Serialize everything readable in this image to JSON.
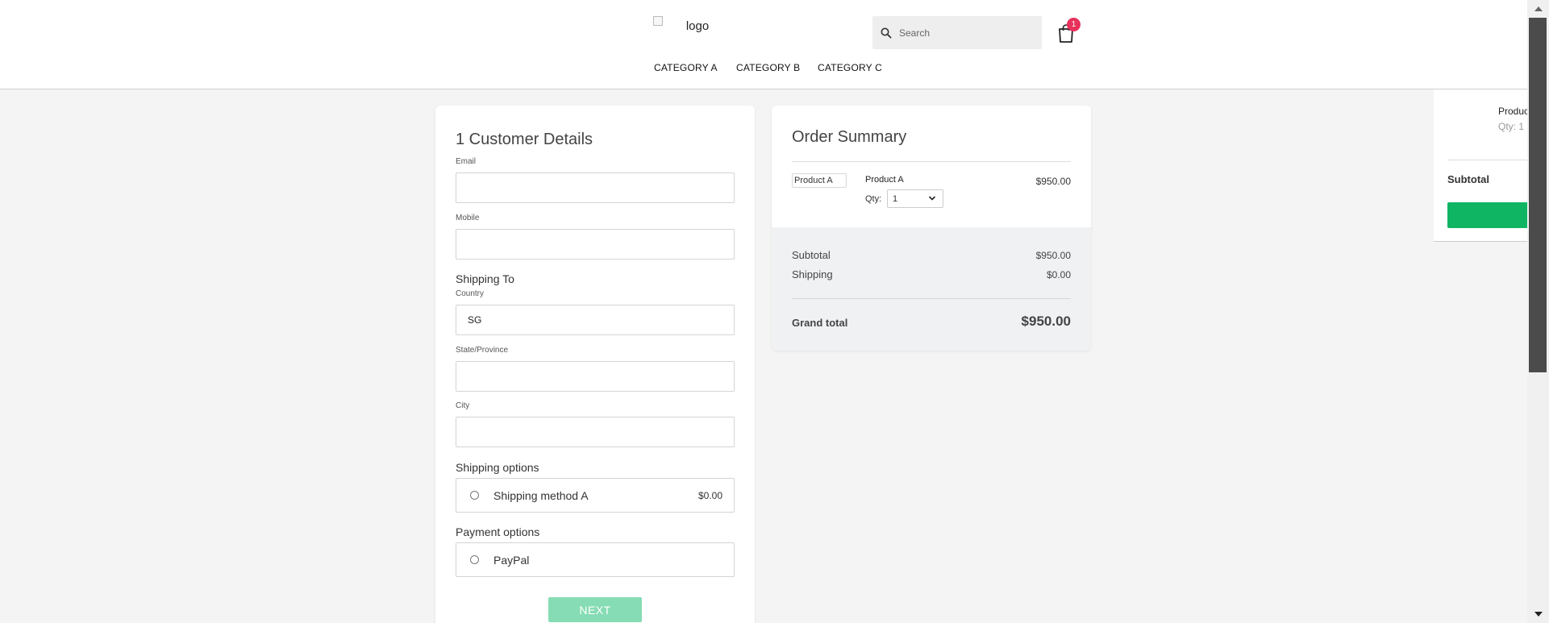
{
  "header": {
    "logo_alt": "logo",
    "search_placeholder": "Search",
    "cart_count": "1",
    "nav": [
      "CATEGORY A",
      "CATEGORY B",
      "CATEGORY C"
    ]
  },
  "customer": {
    "title": "1 Customer Details",
    "email_label": "Email",
    "email_value": "",
    "mobile_label": "Mobile",
    "mobile_value": "",
    "shipping_to": "Shipping To",
    "country_label": "Country",
    "country_value": "SG",
    "state_label": "State/Province",
    "state_value": "",
    "city_label": "City",
    "city_value": "",
    "shipping_options_heading": "Shipping options",
    "shipping_method": "Shipping method A",
    "shipping_price": "$0.00",
    "payment_options_heading": "Payment options",
    "payment_method": "PayPal",
    "next_label": "NEXT"
  },
  "summary": {
    "title": "Order Summary",
    "product_img_alt": "Product A",
    "product_name": "Product A",
    "product_price": "$950.00",
    "qty_label": "Qty:",
    "qty_value": "1",
    "subtotal_label": "Subtotal",
    "subtotal_value": "$950.00",
    "shipping_label": "Shipping",
    "shipping_value": "$0.00",
    "grand_label": "Grand total",
    "grand_value": "$950.00"
  },
  "drawer": {
    "product_name": "Product A",
    "qty": "Qty: 1",
    "subtotal_label": "Subtotal"
  },
  "colors": {
    "accent_green": "#10b563",
    "next_disabled": "#86dcb4",
    "badge": "#e8315b"
  }
}
